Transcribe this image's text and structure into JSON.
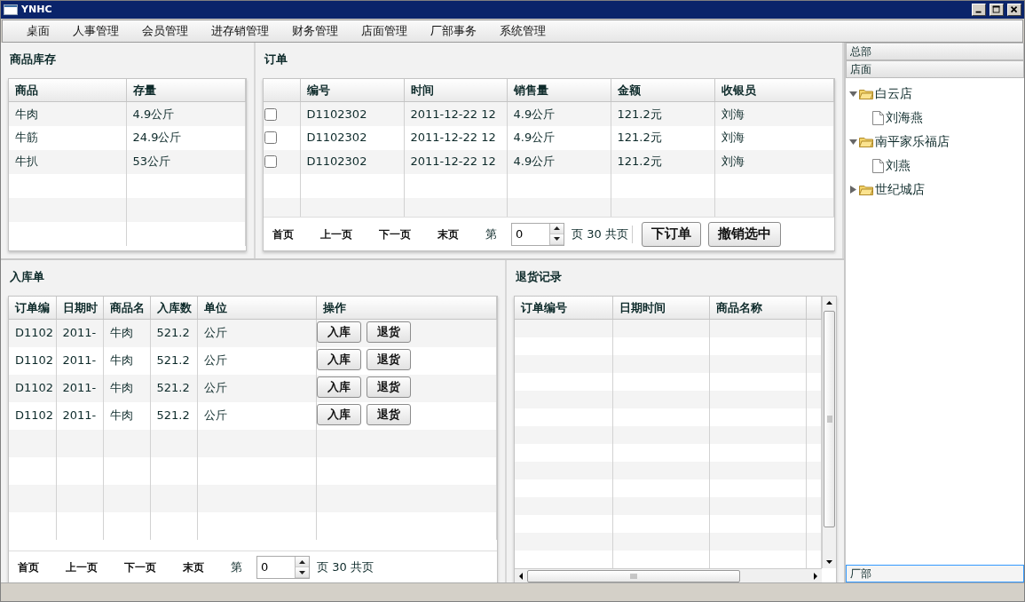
{
  "window": {
    "title": "YNHC"
  },
  "menu": [
    "桌面",
    "人事管理",
    "会员管理",
    "进存销管理",
    "财务管理",
    "店面管理",
    "厂部事务",
    "系统管理"
  ],
  "stock": {
    "title": "商品库存",
    "columns": [
      "商品",
      "存量"
    ],
    "rows": [
      [
        "牛肉",
        "4.9公斤"
      ],
      [
        "牛筋",
        "24.9公斤"
      ],
      [
        "牛扒",
        "53公斤"
      ]
    ]
  },
  "orders": {
    "title": "订单",
    "columns": [
      "编号",
      "时间",
      "销售量",
      "金额",
      "收银员"
    ],
    "rows": [
      {
        "checked": false,
        "cells": [
          "D1102302",
          "2011-12-22 12",
          "4.9公斤",
          "121.2元",
          "刘海"
        ]
      },
      {
        "checked": false,
        "cells": [
          "D1102302",
          "2011-12-22 12",
          "4.9公斤",
          "121.2元",
          "刘海"
        ]
      },
      {
        "checked": false,
        "cells": [
          "D1102302",
          "2011-12-22 12",
          "4.9公斤",
          "121.2元",
          "刘海"
        ]
      }
    ],
    "pager": {
      "first": "首页",
      "prev": "上一页",
      "next": "下一页",
      "last": "末页",
      "page_label": "第",
      "page_value": "0",
      "total": "页 30 共页"
    },
    "buttons": [
      "下订单",
      "撤销选中"
    ]
  },
  "inbound": {
    "title": "入库单",
    "columns": [
      "订单编",
      "日期时",
      "商品名",
      "入库数",
      "单位",
      "操作"
    ],
    "rows": [
      {
        "cells": [
          "D1102",
          "2011-",
          "牛肉",
          "521.2",
          "公斤"
        ],
        "actions": [
          "入库",
          "退货"
        ]
      },
      {
        "cells": [
          "D1102",
          "2011-",
          "牛肉",
          "521.2",
          "公斤"
        ],
        "actions": [
          "入库",
          "退货"
        ]
      },
      {
        "cells": [
          "D1102",
          "2011-",
          "牛肉",
          "521.2",
          "公斤"
        ],
        "actions": [
          "入库",
          "退货"
        ]
      },
      {
        "cells": [
          "D1102",
          "2011-",
          "牛肉",
          "521.2",
          "公斤"
        ],
        "actions": [
          "入库",
          "退货"
        ]
      }
    ],
    "pager": {
      "first": "首页",
      "prev": "上一页",
      "next": "下一页",
      "last": "末页",
      "page_label": "第",
      "page_value": "0",
      "total": "页 30 共页"
    }
  },
  "returns": {
    "title": "退货记录",
    "columns": [
      "订单编号",
      "日期时间",
      "商品名称"
    ]
  },
  "sidebar": {
    "sections": [
      {
        "label": "总部",
        "selected": false
      },
      {
        "label": "店面",
        "expanded": true,
        "selected": false,
        "tree": [
          {
            "label": "白云店",
            "kind": "folder",
            "expanded": true,
            "children": [
              {
                "label": "刘海燕",
                "kind": "file"
              }
            ]
          },
          {
            "label": "南平家乐福店",
            "kind": "folder",
            "expanded": true,
            "children": [
              {
                "label": "刘燕",
                "kind": "file"
              }
            ]
          },
          {
            "label": "世纪城店",
            "kind": "folder",
            "expanded": false
          }
        ]
      },
      {
        "label": "厂部",
        "selected": true
      }
    ]
  }
}
